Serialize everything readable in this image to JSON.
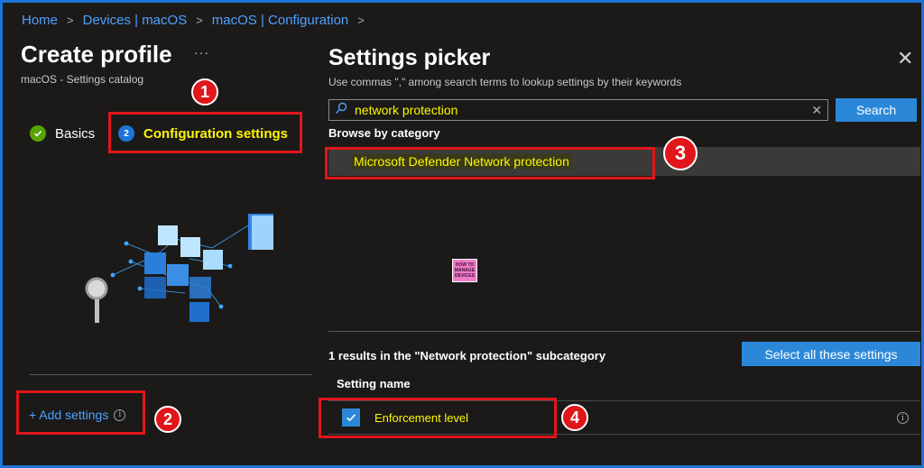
{
  "breadcrumb": {
    "items": [
      "Home",
      "Devices | macOS",
      "macOS | Configuration"
    ],
    "separator": ">"
  },
  "left": {
    "title": "Create profile",
    "menu": "···",
    "subtitle": "macOS - Settings catalog",
    "steps": [
      {
        "label": "Basics",
        "state": "complete"
      },
      {
        "label": "Configuration settings",
        "number": "2",
        "state": "current"
      }
    ],
    "add_settings": "+ Add settings",
    "info_glyph": "i"
  },
  "picker": {
    "title": "Settings picker",
    "close": "✕",
    "hint": "Use commas \",\" among search terms to lookup settings by their keywords",
    "search_value": "network protection",
    "search_button": "Search",
    "clear": "✕",
    "browse_label": "Browse by category",
    "category": "Microsoft Defender Network protection",
    "results_text": "1 results in the \"Network protection\" subcategory",
    "select_all": "Select all these settings",
    "column_header": "Setting name",
    "rows": [
      {
        "name": "Enforcement level",
        "checked": true
      }
    ]
  },
  "annotations": [
    "1",
    "2",
    "3",
    "4"
  ],
  "watermark": {
    "line1": "HOW TO",
    "line2": "MANAGE",
    "line3": "DEVICES"
  },
  "colors": {
    "accent": "#2b88d8",
    "link": "#4ea1ff",
    "highlight_text": "#fff700",
    "annotation_red": "#e0161b",
    "background": "#1b1a19"
  }
}
